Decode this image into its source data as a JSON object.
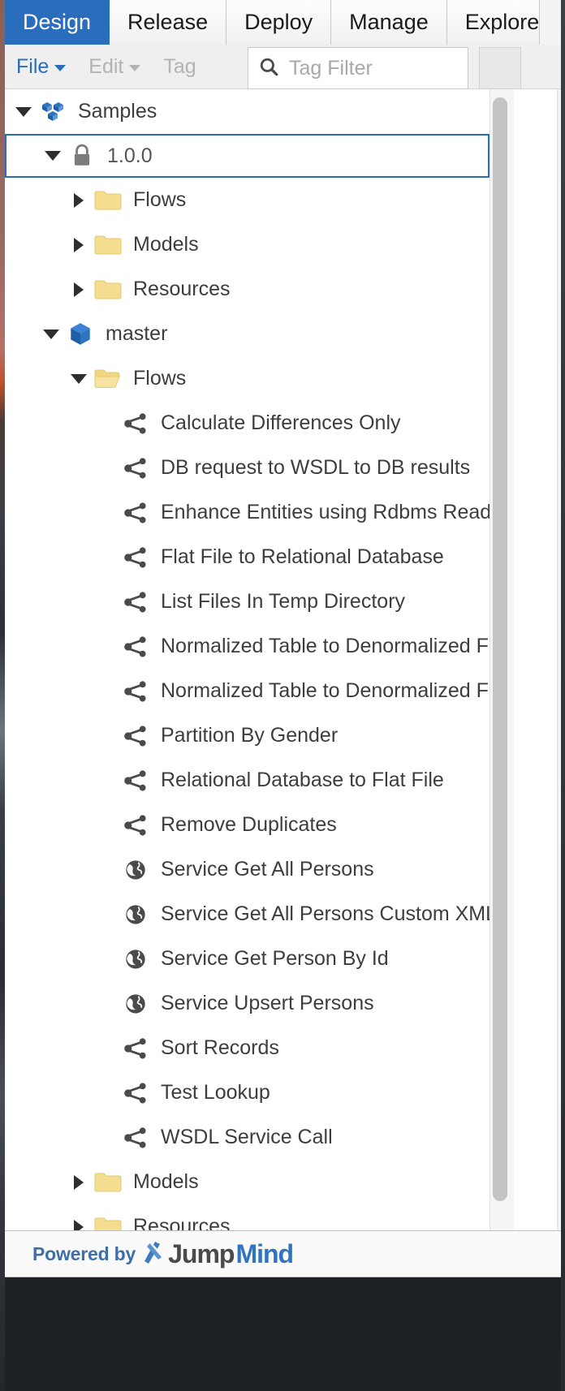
{
  "window": {
    "accent_color": "#2a6dbd",
    "folder_color": "#f5dd8f"
  },
  "tabs": [
    {
      "label": "Design",
      "active": true
    },
    {
      "label": "Release",
      "active": false
    },
    {
      "label": "Deploy",
      "active": false
    },
    {
      "label": "Manage",
      "active": false
    },
    {
      "label": "Explore",
      "active": false
    }
  ],
  "toolbar": {
    "file_label": "File",
    "edit_label": "Edit",
    "tag_label": "Tag",
    "file_enabled": true,
    "edit_enabled": false,
    "tag_enabled": false,
    "search_icon": "search-icon"
  },
  "search": {
    "value": "",
    "placeholder": "Tag Filter"
  },
  "tree": [
    {
      "label": "Samples",
      "icon": "project-cubes-icon",
      "indent": 0,
      "twisty": "down",
      "selected": false
    },
    {
      "label": "1.0.0",
      "icon": "lock-icon",
      "indent": 1,
      "twisty": "down",
      "selected": true
    },
    {
      "label": "Flows",
      "icon": "folder-closed-icon",
      "indent": 2,
      "twisty": "right",
      "selected": false
    },
    {
      "label": "Models",
      "icon": "folder-closed-icon",
      "indent": 2,
      "twisty": "right",
      "selected": false
    },
    {
      "label": "Resources",
      "icon": "folder-closed-icon",
      "indent": 2,
      "twisty": "right",
      "selected": false
    },
    {
      "label": "master",
      "icon": "cube-icon",
      "indent": 1,
      "twisty": "down",
      "selected": false
    },
    {
      "label": "Flows",
      "icon": "folder-open-icon",
      "indent": 2,
      "twisty": "down",
      "selected": false
    },
    {
      "label": "Calculate Differences Only",
      "icon": "flow-icon",
      "indent": 3,
      "twisty": "none",
      "selected": false
    },
    {
      "label": "DB request to WSDL to DB results",
      "icon": "flow-icon",
      "indent": 3,
      "twisty": "none",
      "selected": false
    },
    {
      "label": "Enhance Entities using Rdbms Reader",
      "icon": "flow-icon",
      "indent": 3,
      "twisty": "none",
      "selected": false
    },
    {
      "label": "Flat File to Relational Database",
      "icon": "flow-icon",
      "indent": 3,
      "twisty": "none",
      "selected": false
    },
    {
      "label": "List Files In Temp Directory",
      "icon": "flow-icon",
      "indent": 3,
      "twisty": "none",
      "selected": false
    },
    {
      "label": "Normalized Table to Denormalized File",
      "icon": "flow-icon",
      "indent": 3,
      "twisty": "none",
      "selected": false
    },
    {
      "label": "Normalized Table to Denormalized File v",
      "icon": "flow-icon",
      "indent": 3,
      "twisty": "none",
      "selected": false
    },
    {
      "label": "Partition By Gender",
      "icon": "flow-icon",
      "indent": 3,
      "twisty": "none",
      "selected": false
    },
    {
      "label": "Relational Database to Flat File",
      "icon": "flow-icon",
      "indent": 3,
      "twisty": "none",
      "selected": false
    },
    {
      "label": "Remove Duplicates",
      "icon": "flow-icon",
      "indent": 3,
      "twisty": "none",
      "selected": false
    },
    {
      "label": "Service Get All Persons",
      "icon": "globe-icon",
      "indent": 3,
      "twisty": "none",
      "selected": false
    },
    {
      "label": "Service Get All Persons Custom XML",
      "icon": "globe-icon",
      "indent": 3,
      "twisty": "none",
      "selected": false
    },
    {
      "label": "Service Get Person By Id",
      "icon": "globe-icon",
      "indent": 3,
      "twisty": "none",
      "selected": false
    },
    {
      "label": "Service Upsert Persons",
      "icon": "globe-icon",
      "indent": 3,
      "twisty": "none",
      "selected": false
    },
    {
      "label": "Sort Records",
      "icon": "flow-icon",
      "indent": 3,
      "twisty": "none",
      "selected": false
    },
    {
      "label": "Test Lookup",
      "icon": "flow-icon",
      "indent": 3,
      "twisty": "none",
      "selected": false
    },
    {
      "label": "WSDL Service Call",
      "icon": "flow-icon",
      "indent": 3,
      "twisty": "none",
      "selected": false
    },
    {
      "label": "Models",
      "icon": "folder-closed-icon",
      "indent": 2,
      "twisty": "right",
      "selected": false
    },
    {
      "label": "Resources",
      "icon": "folder-closed-icon",
      "indent": 2,
      "twisty": "right",
      "selected": false
    }
  ],
  "footer": {
    "powered_by": "Powered by",
    "brand_first": "Jump",
    "brand_second": "Mind"
  }
}
